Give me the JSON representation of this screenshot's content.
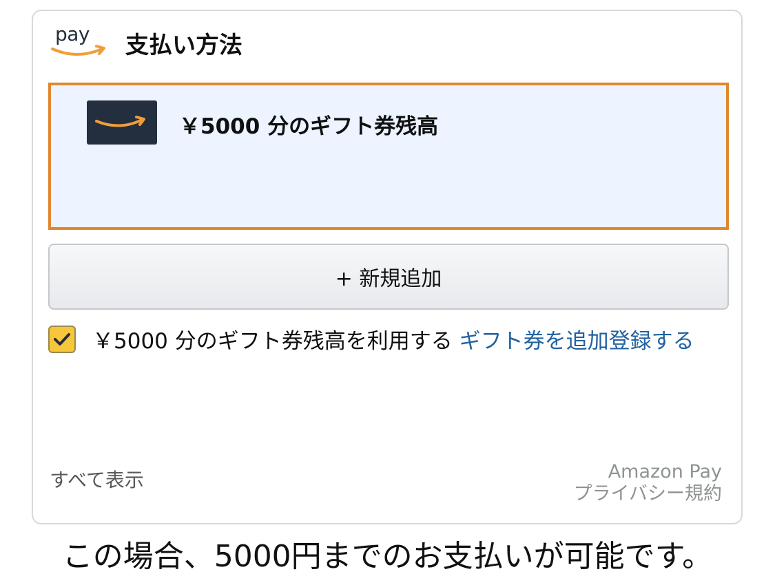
{
  "header": {
    "logo_text": "pay",
    "title": "支払い方法"
  },
  "selected_payment": {
    "label": "￥5000 分のギフト券残高",
    "icon": "amazon-smile-icon"
  },
  "add_button": {
    "label": "+ 新規追加"
  },
  "gift_balance": {
    "checked": true,
    "label": "￥5000 分のギフト券残高を利用する",
    "link_label": "ギフト券を追加登録する"
  },
  "footer": {
    "show_all": "すべて表示",
    "privacy_line1": "Amazon Pay",
    "privacy_line2": "プライバシー規約"
  },
  "caption": "この場合、5000円までのお支払いが可能です。",
  "colors": {
    "accent_border": "#e0872f",
    "selected_bg": "#edf3ff",
    "link": "#2162a1",
    "checkbox": "#f8c63a"
  }
}
